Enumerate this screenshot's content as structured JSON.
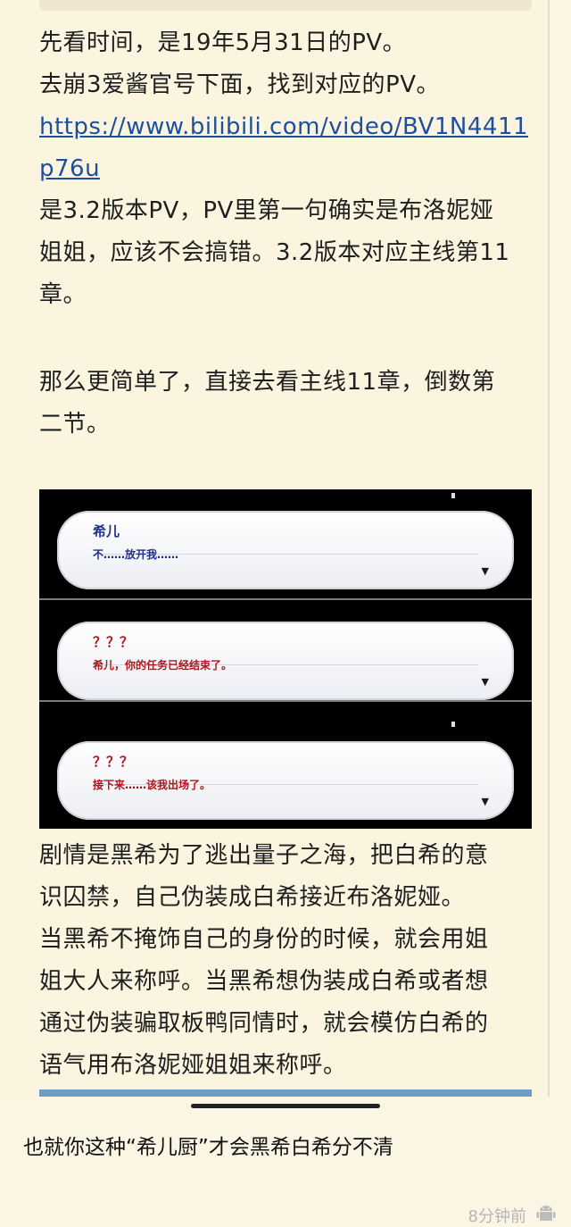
{
  "post": {
    "lines": [
      "先看时间，是19年5月31日的PV。",
      "去崩3爱酱官号下面，找到对应的PV。",
      "https://www.bilibili.com/video/BV1N4411",
      "p76u",
      "是3.2版本PV，PV里第一句确实是布洛妮娅",
      "姐姐，应该不会搞错。3.2版本对应主线第11",
      "章。",
      "那么更简单了，直接去看主线11章，倒数第",
      "二节。"
    ],
    "after_lines": [
      "剧情是黑希为了逃出量子之海，把白希的意",
      "识囚禁，自己伪装成白希接近布洛妮娅。",
      "当黑希不掩饰自己的身份的时候，就会用姐",
      "姐大人来称呼。当黑希想伪装成白希或者想",
      "通过伪装骗取板鸭同情时，就会模仿白希的",
      "语气用布洛妮娅姐姐来称呼。"
    ]
  },
  "dialogs": [
    {
      "speaker": "希儿",
      "text": "不……放开我……",
      "color": "#1f2f8c"
    },
    {
      "speaker": "？？？",
      "text": "希儿，你的任务已经结束了。",
      "color": "#b0141c"
    },
    {
      "speaker": "？？？",
      "text": "接下来……该我出场了。",
      "color": "#b0141c"
    }
  ],
  "comment": {
    "text": "也就你这种“希儿厨”才会黑希白希分不清",
    "time": "8分钟前",
    "icon": "android-icon"
  }
}
